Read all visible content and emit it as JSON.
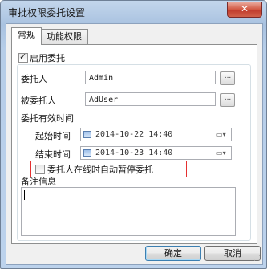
{
  "window": {
    "title": "审批权限委托设置",
    "close_glyph": "✕"
  },
  "tabs": [
    {
      "label": "常规",
      "active": true
    },
    {
      "label": "功能权限",
      "active": false
    }
  ],
  "enable_delegation": {
    "label": "启用委托",
    "checked": true
  },
  "delegator": {
    "label": "委托人",
    "value": "Admin",
    "button": "..."
  },
  "delegatee": {
    "label": "被委托人",
    "value": "AdUser",
    "button": "..."
  },
  "valid_time": {
    "label": "委托有效时间",
    "start_label": "起始时间",
    "start_value": "2014-10-22 14:40",
    "end_label": "结束时间",
    "end_value": "2014-10-23 14:40",
    "dropdown_glyph": "▾"
  },
  "auto_pause": {
    "label": "委托人在线时自动暂停委托",
    "checked": false
  },
  "remarks": {
    "label": "备注信息",
    "value": ""
  },
  "buttons": {
    "ok": "确定",
    "cancel": "取消"
  },
  "colors": {
    "highlight_border": "#e53030"
  }
}
